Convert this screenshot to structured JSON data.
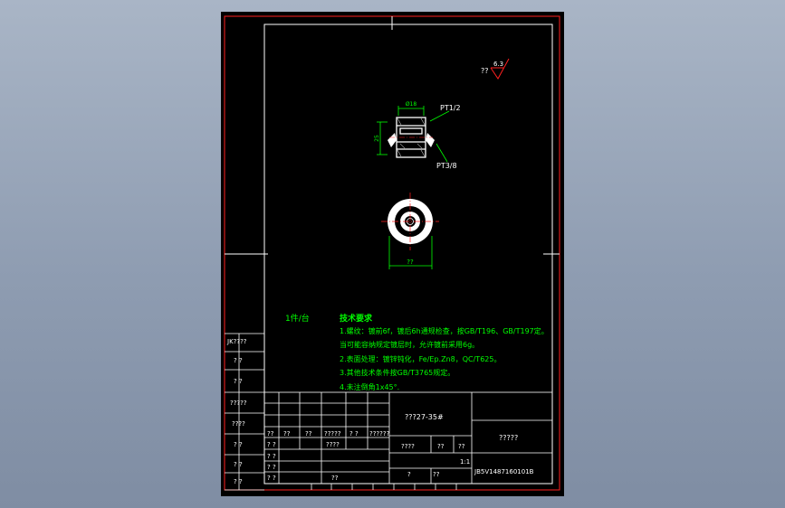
{
  "colors": {
    "background": "#000000",
    "border": "#ff2020",
    "frame": "#ffffff",
    "dimension": "#00ff00",
    "notes": "#00ff00",
    "part": "#ffffff",
    "centerline": "#ff2020",
    "table_text": "#ffffff"
  },
  "surface_finish": {
    "prefix": "??",
    "value": "6.3"
  },
  "section_view": {
    "width_dim": "Ø18",
    "height_dim": "25",
    "thread_top": "PT1/2",
    "thread_bottom": "PT3/8"
  },
  "top_view": {
    "diameter_dim": "??"
  },
  "quantity_note": "1件/台",
  "technical_requirements": {
    "title": "技术要求",
    "lines": [
      "1.螺纹：镀前6f，镀后6h通规检查，按GB/T196、GB/T197定。",
      "当可能容纳规定镀层时，允许镀前采用6g。",
      "2.表面处理：镀锌钝化，Fe/Ep.Zn8，QC/T625。",
      "3.其他技术条件按GB/T3765规定。",
      "4.未注倒角1x45°."
    ]
  },
  "left_strip": {
    "cells": [
      "JK????",
      "?  ?",
      "?  ?",
      "?????",
      "????",
      "?  ?",
      "?  ?",
      "?  ?"
    ]
  },
  "title_block": {
    "material": "???27-35#",
    "part_name": "?????",
    "weight_label": "????",
    "scale_label": "??",
    "sheet_label": "??",
    "sheet_value": "1:1",
    "drawing_number": "JB5V1487160101B",
    "row_headers": [
      "??",
      "??",
      "??",
      "?????",
      "?  ?",
      "??????"
    ],
    "left_rows": [
      "?  ?",
      "?  ?",
      "?  ?",
      "?  ?"
    ],
    "mid_label": "????",
    "bottom_labels": [
      "??",
      "?",
      "??"
    ]
  }
}
